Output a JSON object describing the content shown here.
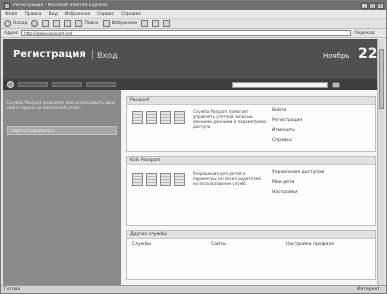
{
  "window": {
    "title": "Регистрация - Microsoft Internet Explorer",
    "controls": [
      "_",
      "□",
      "×"
    ]
  },
  "menu": [
    "Файл",
    "Правка",
    "Вид",
    "Избранное",
    "Сервис",
    "Справка"
  ],
  "toolbar": {
    "back_label": "Назад",
    "search_label": "Поиск",
    "favorites_label": "Избранное"
  },
  "address": {
    "label": "Адрес",
    "value": "http://www.passport.net",
    "go_label": "Переход"
  },
  "banner": {
    "brand": "Регистрация",
    "separator": "|",
    "login": "Вход",
    "month": "Ноябрь",
    "day": "22"
  },
  "sidebar": {
    "intro": "Служба Passport позволяет вам использовать одно имя и пароль на многих веб-узлах.",
    "tab_label": "Зарегистрироваться"
  },
  "sections": [
    {
      "header": "Passport",
      "description": "Служба Passport помогает управлять учетной записью, личными данными и параметрами доступа.",
      "links": [
        "Войти",
        "Регистрация",
        "Изменить",
        "Справка"
      ]
    },
    {
      "header": "Kids Passport",
      "description": "Разрешения для детей и параметры согласия родителей на использование служб.",
      "links": [
        "Управление доступом",
        "Мои дети",
        "Настройки"
      ]
    },
    {
      "header": "Другие службы",
      "description": "",
      "links": [
        "Службы",
        "Сайты",
        "Настройки профиля"
      ]
    }
  ],
  "status": {
    "text": "Готово",
    "zone": "Интернет"
  }
}
